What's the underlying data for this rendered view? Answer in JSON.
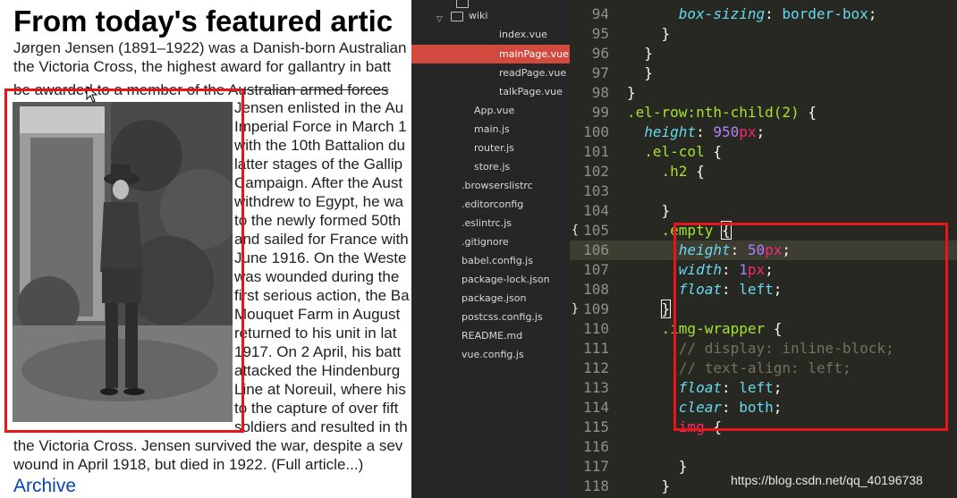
{
  "webpage": {
    "heading": "From today's featured artic",
    "lines_full_top": [
      "Jørgen Jensen (1891–1922) was a Danish-born Australian",
      "the Victoria Cross, the highest award for gallantry in batt",
      "be awarded to a member of the Australian armed forces"
    ],
    "lines_wrap": [
      "Jensen enlisted in the Au",
      "Imperial Force in March 1",
      "with the 10th Battalion du",
      "latter stages of the Gallip",
      "Campaign. After the Aust",
      "withdrew to Egypt, he wa",
      "to the newly formed 50th",
      "and sailed for France with",
      "June 1916. On the Weste",
      "was wounded during the",
      "first serious action, the Ba",
      "Mouquet Farm in August",
      "returned to his unit in lat",
      "1917. On 2 April, his batt",
      "attacked the Hindenburg",
      "Line at Noreuil, where his",
      "to the capture of over fift",
      "soldiers and resulted in th"
    ],
    "lines_full_bottom": [
      "the Victoria Cross. Jensen survived the war, despite a sev",
      "wound in April 1918, but died in 1922. (Full article...)"
    ],
    "archive_link": "Archive"
  },
  "filetree": {
    "items": [
      {
        "label": "wiki",
        "kind": "folder"
      },
      {
        "label": "index.vue",
        "kind": "file"
      },
      {
        "label": "mainPage.vue",
        "kind": "file",
        "active": true
      },
      {
        "label": "readPage.vue",
        "kind": "file"
      },
      {
        "label": "talkPage.vue",
        "kind": "file"
      },
      {
        "label": "App.vue",
        "kind": "file"
      },
      {
        "label": "main.js",
        "kind": "file"
      },
      {
        "label": "router.js",
        "kind": "file"
      },
      {
        "label": "store.js",
        "kind": "file"
      },
      {
        "label": ".browserslistrc",
        "kind": "file"
      },
      {
        "label": ".editorconfig",
        "kind": "file"
      },
      {
        "label": ".eslintrc.js",
        "kind": "file"
      },
      {
        "label": ".gitignore",
        "kind": "file"
      },
      {
        "label": "babel.config.js",
        "kind": "file"
      },
      {
        "label": "package-lock.json",
        "kind": "file"
      },
      {
        "label": "package.json",
        "kind": "file"
      },
      {
        "label": "postcss.config.js",
        "kind": "file"
      },
      {
        "label": "README.md",
        "kind": "file"
      },
      {
        "label": "vue.config.js",
        "kind": "file"
      }
    ]
  },
  "editor": {
    "current_line": "106",
    "lines": [
      {
        "n": "94",
        "code": [
          [
            "      ",
            "t-punc"
          ],
          [
            "box-sizing",
            "t-prop"
          ],
          [
            ": ",
            "t-punc"
          ],
          [
            "border-box",
            "t-val"
          ],
          [
            ";",
            "t-punc"
          ]
        ]
      },
      {
        "n": "95",
        "code": [
          [
            "    }",
            "t-punc"
          ]
        ]
      },
      {
        "n": "96",
        "code": [
          [
            "  }",
            "t-punc"
          ]
        ]
      },
      {
        "n": "97",
        "code": [
          [
            "  }",
            "t-punc"
          ]
        ]
      },
      {
        "n": "98",
        "code": [
          [
            "}",
            "t-punc"
          ]
        ]
      },
      {
        "n": "99",
        "code": [
          [
            ".el-row:nth-child(2)",
            "t-sel"
          ],
          [
            " {",
            "t-punc"
          ]
        ]
      },
      {
        "n": "100",
        "code": [
          [
            "  ",
            "t-punc"
          ],
          [
            "height",
            "t-prop"
          ],
          [
            ": ",
            "t-punc"
          ],
          [
            "950",
            "t-num"
          ],
          [
            "px",
            "t-unit"
          ],
          [
            ";",
            "t-punc"
          ]
        ]
      },
      {
        "n": "101",
        "code": [
          [
            "  ",
            "t-punc"
          ],
          [
            ".el-col",
            "t-sel"
          ],
          [
            " {",
            "t-punc"
          ]
        ]
      },
      {
        "n": "102",
        "code": [
          [
            "    ",
            "t-punc"
          ],
          [
            ".h2",
            "t-sel"
          ],
          [
            " {",
            "t-punc"
          ]
        ]
      },
      {
        "n": "103",
        "code": [
          [
            "",
            "t-punc"
          ]
        ]
      },
      {
        "n": "104",
        "code": [
          [
            "    }",
            "t-punc"
          ]
        ]
      },
      {
        "n": "105",
        "fold": "{",
        "code": [
          [
            "    ",
            "t-punc"
          ],
          [
            ".empty",
            "t-sel"
          ],
          [
            " ",
            "t-punc"
          ],
          [
            "{",
            "bracket-box"
          ]
        ]
      },
      {
        "n": "106",
        "code": [
          [
            "      ",
            "t-punc"
          ],
          [
            "height",
            "t-prop"
          ],
          [
            ": ",
            "t-punc"
          ],
          [
            "50",
            "t-num"
          ],
          [
            "px",
            "t-unit"
          ],
          [
            ";",
            "t-punc"
          ]
        ]
      },
      {
        "n": "107",
        "code": [
          [
            "      ",
            "t-punc"
          ],
          [
            "width",
            "t-prop"
          ],
          [
            ": ",
            "t-punc"
          ],
          [
            "1",
            "t-num"
          ],
          [
            "px",
            "t-unit"
          ],
          [
            ";",
            "t-punc"
          ]
        ]
      },
      {
        "n": "108",
        "code": [
          [
            "      ",
            "t-punc"
          ],
          [
            "float",
            "t-prop"
          ],
          [
            ": ",
            "t-punc"
          ],
          [
            "left",
            "t-val"
          ],
          [
            ";",
            "t-punc"
          ]
        ]
      },
      {
        "n": "109",
        "fold": "}",
        "code": [
          [
            "    ",
            "t-punc"
          ],
          [
            "}",
            "bracket-box"
          ]
        ]
      },
      {
        "n": "110",
        "code": [
          [
            "    ",
            "t-punc"
          ],
          [
            ".img-wrapper",
            "t-sel"
          ],
          [
            " {",
            "t-punc"
          ]
        ]
      },
      {
        "n": "111",
        "code": [
          [
            "      ",
            "t-punc"
          ],
          [
            "// display: inline-block;",
            "t-cmt"
          ]
        ]
      },
      {
        "n": "112",
        "code": [
          [
            "      ",
            "t-punc"
          ],
          [
            "// text-align: left;",
            "t-cmt"
          ]
        ]
      },
      {
        "n": "113",
        "code": [
          [
            "      ",
            "t-punc"
          ],
          [
            "float",
            "t-prop"
          ],
          [
            ": ",
            "t-punc"
          ],
          [
            "left",
            "t-val"
          ],
          [
            ";",
            "t-punc"
          ]
        ]
      },
      {
        "n": "114",
        "code": [
          [
            "      ",
            "t-punc"
          ],
          [
            "clear",
            "t-prop"
          ],
          [
            ": ",
            "t-punc"
          ],
          [
            "both",
            "t-val"
          ],
          [
            ";",
            "t-punc"
          ]
        ]
      },
      {
        "n": "115",
        "code": [
          [
            "      ",
            "t-punc"
          ],
          [
            "img",
            "t-unit"
          ],
          [
            " {",
            "t-punc"
          ]
        ]
      },
      {
        "n": "116",
        "code": [
          [
            "",
            "t-punc"
          ]
        ]
      },
      {
        "n": "117",
        "code": [
          [
            "      }",
            "t-punc"
          ]
        ]
      },
      {
        "n": "118",
        "code": [
          [
            "    }",
            "t-punc"
          ]
        ]
      }
    ]
  },
  "watermark": "https://blog.csdn.net/qq_40196738",
  "colors": {
    "highlight_box": "#e8151b",
    "active_file": "#d24a3e",
    "editor_bg": "#272822",
    "link": "#0645ad"
  }
}
